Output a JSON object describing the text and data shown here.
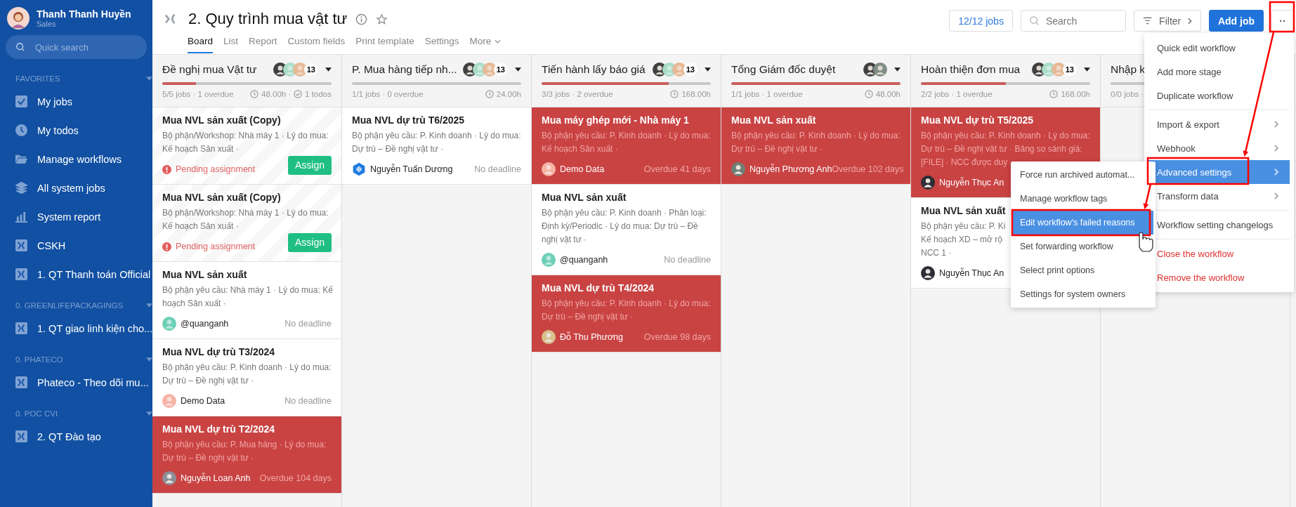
{
  "user": {
    "name": "Thanh Thanh Huyền",
    "role": "Sales"
  },
  "quick_search": {
    "placeholder": "Quick search"
  },
  "sidebar": {
    "sections": [
      {
        "title": "FAVORITES",
        "items": [
          {
            "label": "My jobs",
            "kind": "check"
          },
          {
            "label": "My todos",
            "kind": "clock"
          },
          {
            "label": "Manage workflows",
            "kind": "folder"
          },
          {
            "label": "All system jobs",
            "kind": "layers"
          },
          {
            "label": "System report",
            "kind": "chart"
          },
          {
            "label": "CSKH",
            "kind": "workflow"
          },
          {
            "label": "1. QT Thanh toán Official",
            "kind": "workflow"
          }
        ]
      },
      {
        "title": "0. GREENLIFEPACKAGINGS",
        "items": [
          {
            "label": "1. QT giao linh kiện cho...",
            "kind": "workflow"
          }
        ]
      },
      {
        "title": "0. PHATECO",
        "items": [
          {
            "label": "Phateco - Theo dõi mu...",
            "kind": "workflow"
          }
        ]
      },
      {
        "title": "0. POC CVI",
        "items": [
          {
            "label": "2. QT Đào tạo",
            "kind": "workflow"
          }
        ]
      }
    ]
  },
  "header": {
    "title": "2. Quy trình mua vật tư",
    "tabs": [
      {
        "label": "Board",
        "selected": true
      },
      {
        "label": "List",
        "selected": false
      },
      {
        "label": "Report",
        "selected": false
      },
      {
        "label": "Custom fields",
        "selected": false
      },
      {
        "label": "Print template",
        "selected": false
      },
      {
        "label": "Settings",
        "selected": false
      },
      {
        "label": "More",
        "selected": false,
        "dropdown": true
      }
    ],
    "job_count": "12/12 jobs",
    "search": {
      "placeholder": "Search"
    },
    "filter": "Filter",
    "add_job": "Add job",
    "more_button": "··"
  },
  "columns": [
    {
      "title": "Đề nghị mua Vật tư",
      "avatars": [
        {
          "kind": "photo",
          "color": "#3f3f3f"
        },
        {
          "kind": "person",
          "color": "#a9ddc9"
        },
        {
          "kind": "person",
          "color": "#e6b996"
        }
      ],
      "member_count": "13",
      "level": 0.2,
      "stats": "5/5 jobs · 1 overdue",
      "hours": "48.00h ·",
      "todos": "1 todos",
      "cards": [
        {
          "kind": "pending",
          "title": "Mua NVL sản xuất (Copy)",
          "desc_lines": [
            "Bộ phận/Workshop: Nhà máy 1 · Lý do mua:",
            "Kế hoạch Sản xuất ·"
          ],
          "status": "Pending assignment",
          "action": "Assign"
        },
        {
          "kind": "pending",
          "title": "Mua NVL sản xuất (Copy)",
          "desc_lines": [
            "Bộ phận/Workshop: Nhà máy 1 · Lý do mua:",
            "Kế hoạch Sản xuất ·"
          ],
          "status": "Pending assignment",
          "action": "Assign"
        },
        {
          "kind": "normal",
          "title": "Mua NVL sản xuất",
          "desc_lines": [
            "Bộ phận yêu cầu: Nhà máy 1 · Lý do mua: Kế",
            "hoạch Sản xuất ·"
          ],
          "owner": {
            "name": "@quanganh",
            "kind": "person",
            "color": "#6dcfb5"
          },
          "due": "No deadline"
        },
        {
          "kind": "normal",
          "title": "Mua NVL dự trù T3/2024",
          "desc_lines": [
            "Bộ phận yêu cầu: P. Kinh doanh · Lý do mua:",
            "Dự trù – Đề nghị vật tư ·"
          ],
          "owner": {
            "name": "Demo Data",
            "kind": "person",
            "color": "#f7b3a6"
          },
          "due": "No deadline"
        },
        {
          "kind": "overdue",
          "title": "Mua NVL dự trù T2/2024",
          "desc_lines": [
            "Bộ phận yêu cầu: P. Mua hàng · Lý do mua:",
            "Dự trù – Đề nghị vật tư ·"
          ],
          "owner": {
            "name": "Nguyễn Loan Anh",
            "kind": "photo",
            "color": "#8a8f99"
          },
          "due": "Overdue 104 days"
        }
      ]
    },
    {
      "title": "P. Mua hàng tiếp nh...",
      "avatars": [
        {
          "kind": "photo",
          "color": "#3f3f3f"
        },
        {
          "kind": "person",
          "color": "#a9ddc9"
        },
        {
          "kind": "person",
          "color": "#e6b996"
        }
      ],
      "member_count": "13",
      "level": 0,
      "stats": "1/1 jobs · 0 overdue",
      "hours": "24.00h",
      "cards": [
        {
          "kind": "normal",
          "title": "Mua NVL dự trù T6/2025",
          "desc_lines": [
            "Bộ phận yêu cầu: P. Kinh doanh · Lý do mua:",
            "Dự trù – Đề nghị vật tư ·"
          ],
          "owner": {
            "name": "Nguyễn Tuấn Dương",
            "kind": "logo",
            "color": "#1e7be0"
          },
          "due": "No deadline"
        }
      ]
    },
    {
      "title": "Tiến hành lấy báo giá",
      "avatars": [
        {
          "kind": "photo",
          "color": "#3f3f3f"
        },
        {
          "kind": "person",
          "color": "#a9ddc9"
        },
        {
          "kind": "person",
          "color": "#e6b996"
        }
      ],
      "member_count": "13",
      "level": 0.75,
      "stats": "3/3 jobs · 2 overdue",
      "hours": "168.00h",
      "cards": [
        {
          "kind": "overdue",
          "title": "Mua máy ghép mới - Nhà máy 1",
          "desc_lines": [
            "Bộ phận yêu cầu: P. Kinh doanh · Lý do mua:",
            "Kế hoạch Sản xuất ·"
          ],
          "owner": {
            "name": "Demo Data",
            "kind": "person",
            "color": "#f7b3a6"
          },
          "due": "Overdue 41 days"
        },
        {
          "kind": "normal",
          "title": "Mua NVL sản xuất",
          "desc_lines": [
            "Bộ phận yêu cầu: P. Kinh doanh · Phân loại:",
            "Định kỳ/Periodic · Lý do mua: Dự trù – Đề",
            "nghị vật tư ·"
          ],
          "owner": {
            "name": "@quanganh",
            "kind": "person",
            "color": "#6dcfb5"
          },
          "due": "No deadline"
        },
        {
          "kind": "overdue",
          "title": "Mua NVL dự trù T4/2024",
          "desc_lines": [
            "Bộ phận yêu cầu: P. Kinh doanh · Lý do mua:",
            "Dự trù – Đề nghị vật tư ·"
          ],
          "owner": {
            "name": "Đỗ Thu Phương",
            "kind": "photo",
            "color": "#d8c08a"
          },
          "due": "Overdue 98 days"
        }
      ]
    },
    {
      "title": "Tổng Giám đốc duyệt",
      "avatars": [
        {
          "kind": "photo",
          "color": "#3f3f3f"
        },
        {
          "kind": "photo",
          "color": "#7f8f86"
        }
      ],
      "level": 1,
      "stats": "1/1 jobs · 1 overdue",
      "hours": "48.00h",
      "cards": [
        {
          "kind": "overdue",
          "title": "Mua NVL sản xuất",
          "desc_lines": [
            "Bộ phận yêu cầu: P. Kinh doanh · Lý do mua:",
            "Dự trù – Đề nghị vật tư ·"
          ],
          "owner": {
            "name": "Nguyễn Phương Anh",
            "kind": "photo",
            "color": "#6f7f78"
          },
          "due": "Overdue 102 days"
        }
      ]
    },
    {
      "title": "Hoàn thiện đơn mua",
      "avatars": [
        {
          "kind": "photo",
          "color": "#3f3f3f"
        },
        {
          "kind": "person",
          "color": "#a9ddc9"
        },
        {
          "kind": "person",
          "color": "#e6b996"
        }
      ],
      "member_count": "13",
      "level": 0.5,
      "stats": "2/2 jobs · 1 overdue",
      "hours": "168.00h",
      "cards": [
        {
          "kind": "overdue",
          "title": "Mua NVL dự trù T5/2025",
          "desc_lines": [
            "Bộ phận yêu cầu: P. Kinh doanh · Lý do mua:",
            "Dự trù – Đề nghị vật tư · Bảng so sánh giá:",
            "[FILE] · NCC được duy"
          ],
          "owner": {
            "name": "Nguyễn Thục An",
            "kind": "photo",
            "color": "#2e2e36"
          }
        },
        {
          "kind": "normal",
          "title": "Mua NVL sản xuất",
          "desc_lines": [
            "Bộ phận yêu cầu: P. Ki",
            "Kế hoạch XD – mở rộ",
            "NCC 1 ·"
          ],
          "owner": {
            "name": "Nguyễn Thục An",
            "kind": "photo",
            "color": "#2e2e36"
          }
        }
      ]
    },
    {
      "title": "Nhập k",
      "level": 0,
      "stats": "0/0 jobs ·"
    }
  ],
  "menu": {
    "groups": [
      [
        {
          "label": "Quick edit workflow",
          "selected": false
        },
        {
          "label": "Add more stage",
          "selected": false
        },
        {
          "label": "Duplicate workflow",
          "selected": false
        }
      ],
      [
        {
          "label": "Import & export",
          "selected": false,
          "submenu": true
        },
        {
          "label": "Webhook",
          "selected": false,
          "submenu": true
        },
        {
          "label": "Advanced settings",
          "selected": true,
          "submenu": true
        },
        {
          "label": "Transform data",
          "selected": false,
          "submenu": true
        }
      ],
      [
        {
          "label": "Workflow setting changelogs",
          "selected": false
        }
      ],
      [
        {
          "label": "Close the workflow",
          "selected": false,
          "danger": true
        },
        {
          "label": "Remove the workflow",
          "selected": false,
          "danger": true
        }
      ]
    ]
  },
  "submenu": {
    "items": [
      {
        "label": "Force run archived automat...",
        "selected": false
      },
      {
        "label": "Manage workflow tags",
        "selected": false
      },
      {
        "label": "Edit workflow's failed reasons",
        "selected": true
      },
      {
        "label": "Set forwarding workflow",
        "selected": false
      },
      {
        "label": "Select print options",
        "selected": false
      },
      {
        "label": "Settings for system owners",
        "selected": false
      }
    ]
  }
}
